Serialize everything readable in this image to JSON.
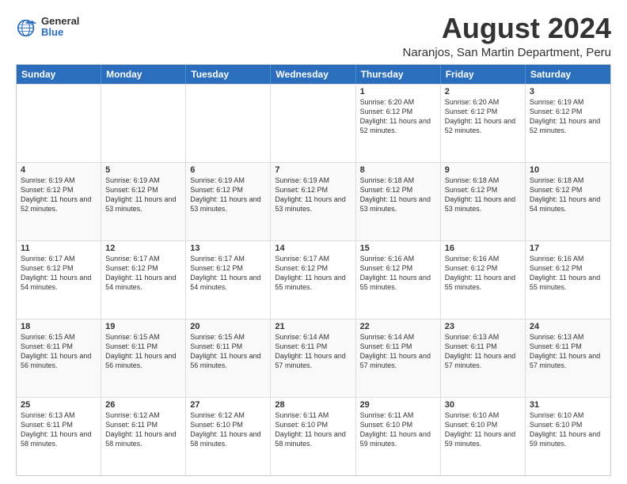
{
  "header": {
    "logo": {
      "general": "General",
      "blue": "Blue"
    },
    "title": "August 2024",
    "subtitle": "Naranjos, San Martin Department, Peru"
  },
  "calendar": {
    "days": [
      "Sunday",
      "Monday",
      "Tuesday",
      "Wednesday",
      "Thursday",
      "Friday",
      "Saturday"
    ],
    "weeks": [
      [
        {
          "day": "",
          "info": ""
        },
        {
          "day": "",
          "info": ""
        },
        {
          "day": "",
          "info": ""
        },
        {
          "day": "",
          "info": ""
        },
        {
          "day": "1",
          "info": "Sunrise: 6:20 AM\nSunset: 6:12 PM\nDaylight: 11 hours and 52 minutes."
        },
        {
          "day": "2",
          "info": "Sunrise: 6:20 AM\nSunset: 6:12 PM\nDaylight: 11 hours and 52 minutes."
        },
        {
          "day": "3",
          "info": "Sunrise: 6:19 AM\nSunset: 6:12 PM\nDaylight: 11 hours and 52 minutes."
        }
      ],
      [
        {
          "day": "4",
          "info": "Sunrise: 6:19 AM\nSunset: 6:12 PM\nDaylight: 11 hours and 52 minutes."
        },
        {
          "day": "5",
          "info": "Sunrise: 6:19 AM\nSunset: 6:12 PM\nDaylight: 11 hours and 53 minutes."
        },
        {
          "day": "6",
          "info": "Sunrise: 6:19 AM\nSunset: 6:12 PM\nDaylight: 11 hours and 53 minutes."
        },
        {
          "day": "7",
          "info": "Sunrise: 6:19 AM\nSunset: 6:12 PM\nDaylight: 11 hours and 53 minutes."
        },
        {
          "day": "8",
          "info": "Sunrise: 6:18 AM\nSunset: 6:12 PM\nDaylight: 11 hours and 53 minutes."
        },
        {
          "day": "9",
          "info": "Sunrise: 6:18 AM\nSunset: 6:12 PM\nDaylight: 11 hours and 53 minutes."
        },
        {
          "day": "10",
          "info": "Sunrise: 6:18 AM\nSunset: 6:12 PM\nDaylight: 11 hours and 54 minutes."
        }
      ],
      [
        {
          "day": "11",
          "info": "Sunrise: 6:17 AM\nSunset: 6:12 PM\nDaylight: 11 hours and 54 minutes."
        },
        {
          "day": "12",
          "info": "Sunrise: 6:17 AM\nSunset: 6:12 PM\nDaylight: 11 hours and 54 minutes."
        },
        {
          "day": "13",
          "info": "Sunrise: 6:17 AM\nSunset: 6:12 PM\nDaylight: 11 hours and 54 minutes."
        },
        {
          "day": "14",
          "info": "Sunrise: 6:17 AM\nSunset: 6:12 PM\nDaylight: 11 hours and 55 minutes."
        },
        {
          "day": "15",
          "info": "Sunrise: 6:16 AM\nSunset: 6:12 PM\nDaylight: 11 hours and 55 minutes."
        },
        {
          "day": "16",
          "info": "Sunrise: 6:16 AM\nSunset: 6:12 PM\nDaylight: 11 hours and 55 minutes."
        },
        {
          "day": "17",
          "info": "Sunrise: 6:16 AM\nSunset: 6:12 PM\nDaylight: 11 hours and 55 minutes."
        }
      ],
      [
        {
          "day": "18",
          "info": "Sunrise: 6:15 AM\nSunset: 6:11 PM\nDaylight: 11 hours and 56 minutes."
        },
        {
          "day": "19",
          "info": "Sunrise: 6:15 AM\nSunset: 6:11 PM\nDaylight: 11 hours and 56 minutes."
        },
        {
          "day": "20",
          "info": "Sunrise: 6:15 AM\nSunset: 6:11 PM\nDaylight: 11 hours and 56 minutes."
        },
        {
          "day": "21",
          "info": "Sunrise: 6:14 AM\nSunset: 6:11 PM\nDaylight: 11 hours and 57 minutes."
        },
        {
          "day": "22",
          "info": "Sunrise: 6:14 AM\nSunset: 6:11 PM\nDaylight: 11 hours and 57 minutes."
        },
        {
          "day": "23",
          "info": "Sunrise: 6:13 AM\nSunset: 6:11 PM\nDaylight: 11 hours and 57 minutes."
        },
        {
          "day": "24",
          "info": "Sunrise: 6:13 AM\nSunset: 6:11 PM\nDaylight: 11 hours and 57 minutes."
        }
      ],
      [
        {
          "day": "25",
          "info": "Sunrise: 6:13 AM\nSunset: 6:11 PM\nDaylight: 11 hours and 58 minutes."
        },
        {
          "day": "26",
          "info": "Sunrise: 6:12 AM\nSunset: 6:11 PM\nDaylight: 11 hours and 58 minutes."
        },
        {
          "day": "27",
          "info": "Sunrise: 6:12 AM\nSunset: 6:10 PM\nDaylight: 11 hours and 58 minutes."
        },
        {
          "day": "28",
          "info": "Sunrise: 6:11 AM\nSunset: 6:10 PM\nDaylight: 11 hours and 58 minutes."
        },
        {
          "day": "29",
          "info": "Sunrise: 6:11 AM\nSunset: 6:10 PM\nDaylight: 11 hours and 59 minutes."
        },
        {
          "day": "30",
          "info": "Sunrise: 6:10 AM\nSunset: 6:10 PM\nDaylight: 11 hours and 59 minutes."
        },
        {
          "day": "31",
          "info": "Sunrise: 6:10 AM\nSunset: 6:10 PM\nDaylight: 11 hours and 59 minutes."
        }
      ]
    ]
  }
}
